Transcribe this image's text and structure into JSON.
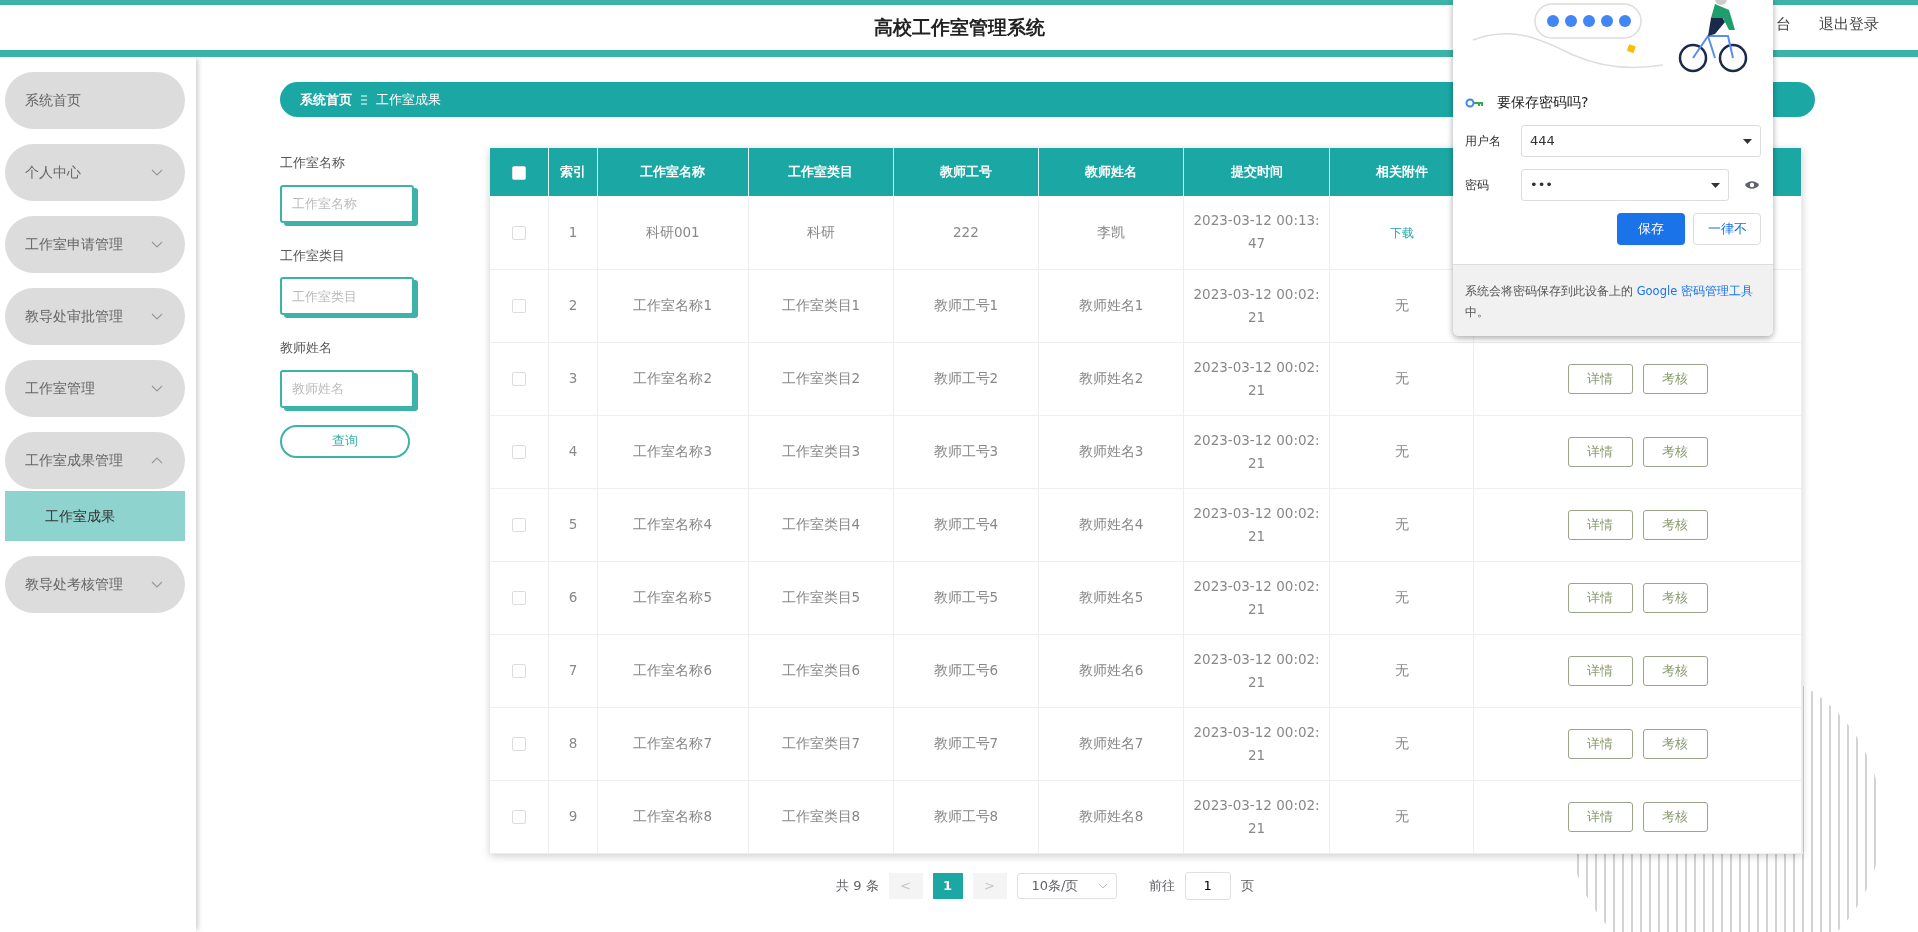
{
  "header": {
    "title": "高校工作室管理系统",
    "links": [
      {
        "label": "台"
      },
      {
        "label": "退出登录"
      }
    ]
  },
  "sidebar": {
    "items": [
      {
        "label": "系统首页",
        "kind": "link"
      },
      {
        "label": "个人中心",
        "kind": "submenu",
        "expanded": false
      },
      {
        "label": "工作室申请管理",
        "kind": "submenu",
        "expanded": false
      },
      {
        "label": "教导处审批管理",
        "kind": "submenu",
        "expanded": false
      },
      {
        "label": "工作室管理",
        "kind": "submenu",
        "expanded": false
      },
      {
        "label": "工作室成果管理",
        "kind": "submenu",
        "expanded": true,
        "children": [
          {
            "label": "工作室成果",
            "selected": true
          }
        ]
      },
      {
        "label": "教导处考核管理",
        "kind": "submenu",
        "expanded": false
      }
    ]
  },
  "breadcrumb": [
    {
      "label": "系统首页"
    },
    {
      "label": "工作室成果"
    }
  ],
  "search": {
    "fields": [
      {
        "label": "工作室名称",
        "placeholder": "工作室名称"
      },
      {
        "label": "工作室类目",
        "placeholder": "工作室类目"
      },
      {
        "label": "教师姓名",
        "placeholder": "教师姓名"
      }
    ],
    "button": "查询"
  },
  "table": {
    "select_all": {
      "checked": false
    },
    "columns": [
      "索引",
      "工作室名称",
      "工作室类目",
      "教师工号",
      "教师姓名",
      "提交时间",
      "相关附件"
    ],
    "rows": [
      {
        "checked": false,
        "cells": [
          "1",
          "科研001",
          "科研",
          "222",
          "李凯",
          "2023-03-12 00:13:47"
        ],
        "attachment": {
          "kind": "link",
          "text": "下载"
        }
      },
      {
        "checked": false,
        "cells": [
          "2",
          "工作室名称1",
          "工作室类目1",
          "教师工号1",
          "教师姓名1",
          "2023-03-12 00:02:21"
        ],
        "attachment": {
          "kind": "text",
          "text": "无"
        }
      },
      {
        "checked": false,
        "cells": [
          "3",
          "工作室名称2",
          "工作室类目2",
          "教师工号2",
          "教师姓名2",
          "2023-03-12 00:02:21"
        ],
        "attachment": {
          "kind": "text",
          "text": "无"
        },
        "actions": [
          "详情",
          "考核"
        ]
      },
      {
        "checked": false,
        "cells": [
          "4",
          "工作室名称3",
          "工作室类目3",
          "教师工号3",
          "教师姓名3",
          "2023-03-12 00:02:21"
        ],
        "attachment": {
          "kind": "text",
          "text": "无"
        },
        "actions": [
          "详情",
          "考核"
        ]
      },
      {
        "checked": false,
        "cells": [
          "5",
          "工作室名称4",
          "工作室类目4",
          "教师工号4",
          "教师姓名4",
          "2023-03-12 00:02:21"
        ],
        "attachment": {
          "kind": "text",
          "text": "无"
        },
        "actions": [
          "详情",
          "考核"
        ]
      },
      {
        "checked": false,
        "cells": [
          "6",
          "工作室名称5",
          "工作室类目5",
          "教师工号5",
          "教师姓名5",
          "2023-03-12 00:02:21"
        ],
        "attachment": {
          "kind": "text",
          "text": "无"
        },
        "actions": [
          "详情",
          "考核"
        ]
      },
      {
        "checked": false,
        "cells": [
          "7",
          "工作室名称6",
          "工作室类目6",
          "教师工号6",
          "教师姓名6",
          "2023-03-12 00:02:21"
        ],
        "attachment": {
          "kind": "text",
          "text": "无"
        },
        "actions": [
          "详情",
          "考核"
        ]
      },
      {
        "checked": false,
        "cells": [
          "8",
          "工作室名称7",
          "工作室类目7",
          "教师工号7",
          "教师姓名7",
          "2023-03-12 00:02:21"
        ],
        "attachment": {
          "kind": "text",
          "text": "无"
        },
        "actions": [
          "详情",
          "考核"
        ]
      },
      {
        "checked": false,
        "cells": [
          "9",
          "工作室名称8",
          "工作室类目8",
          "教师工号8",
          "教师姓名8",
          "2023-03-12 00:02:21"
        ],
        "attachment": {
          "kind": "text",
          "text": "无"
        },
        "actions": [
          "详情",
          "考核"
        ]
      }
    ]
  },
  "pagination": {
    "total": "共 9 条",
    "prev": "<",
    "pages": [
      {
        "label": "1",
        "selected": true
      }
    ],
    "next": ">",
    "page_size": "10条/页",
    "goto_label": "前往",
    "goto_value": "1",
    "goto_suffix": "页"
  },
  "password_dialog": {
    "title": "要保存密码吗?",
    "username_label": "用户名",
    "username": "444",
    "password_label": "密码",
    "password": "•••",
    "buttons": [
      {
        "label": "保存",
        "kind": "primary"
      },
      {
        "label": "一律不",
        "kind": "secondary"
      }
    ],
    "note": "系统会将密码保存到此设备上的",
    "note_link": "Google 密码管理工具",
    "note_end": "中。"
  }
}
